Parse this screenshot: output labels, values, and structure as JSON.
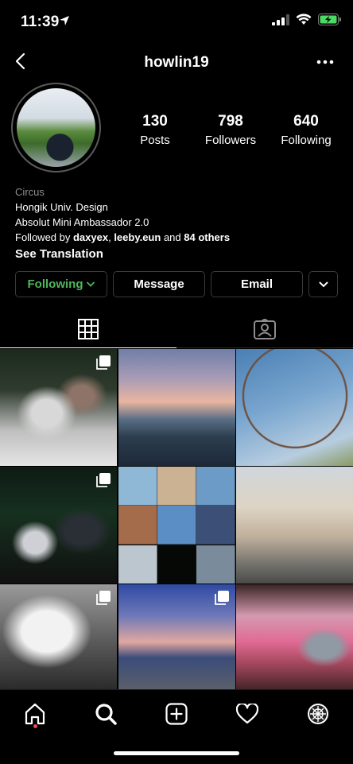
{
  "status": {
    "time": "11:39"
  },
  "header": {
    "username": "howlin19"
  },
  "profile": {
    "stats": [
      {
        "value": "130",
        "label": "Posts"
      },
      {
        "value": "798",
        "label": "Followers"
      },
      {
        "value": "640",
        "label": "Following"
      }
    ],
    "category": "Circus",
    "bio_lines": [
      "Hongik Univ. Design",
      "Absolut Mini Ambassador 2.0"
    ],
    "followed_by": {
      "prefix": "Followed by ",
      "user1": "daxyex",
      "sep": ", ",
      "user2": "leeby.eun",
      "and": " and ",
      "others": "84 others"
    },
    "see_translation": "See Translation"
  },
  "actions": {
    "following_label": "Following",
    "message_label": "Message",
    "email_label": "Email"
  },
  "colors": {
    "following_green": "#4fb75a",
    "notification_dot": "#ed4956",
    "background": "#000000"
  },
  "tabs": [
    {
      "icon": "grid-icon",
      "active": true
    },
    {
      "icon": "tagged-icon",
      "active": false
    }
  ],
  "posts": [
    {
      "multi": true
    },
    {
      "multi": false
    },
    {
      "multi": false
    },
    {
      "multi": true
    },
    {
      "multi": false
    },
    {
      "multi": false
    },
    {
      "multi": true
    },
    {
      "multi": true
    },
    {
      "multi": false
    }
  ],
  "bottom_nav": [
    "home-icon",
    "search-icon",
    "new-post-icon",
    "activity-icon",
    "profile-icon"
  ]
}
